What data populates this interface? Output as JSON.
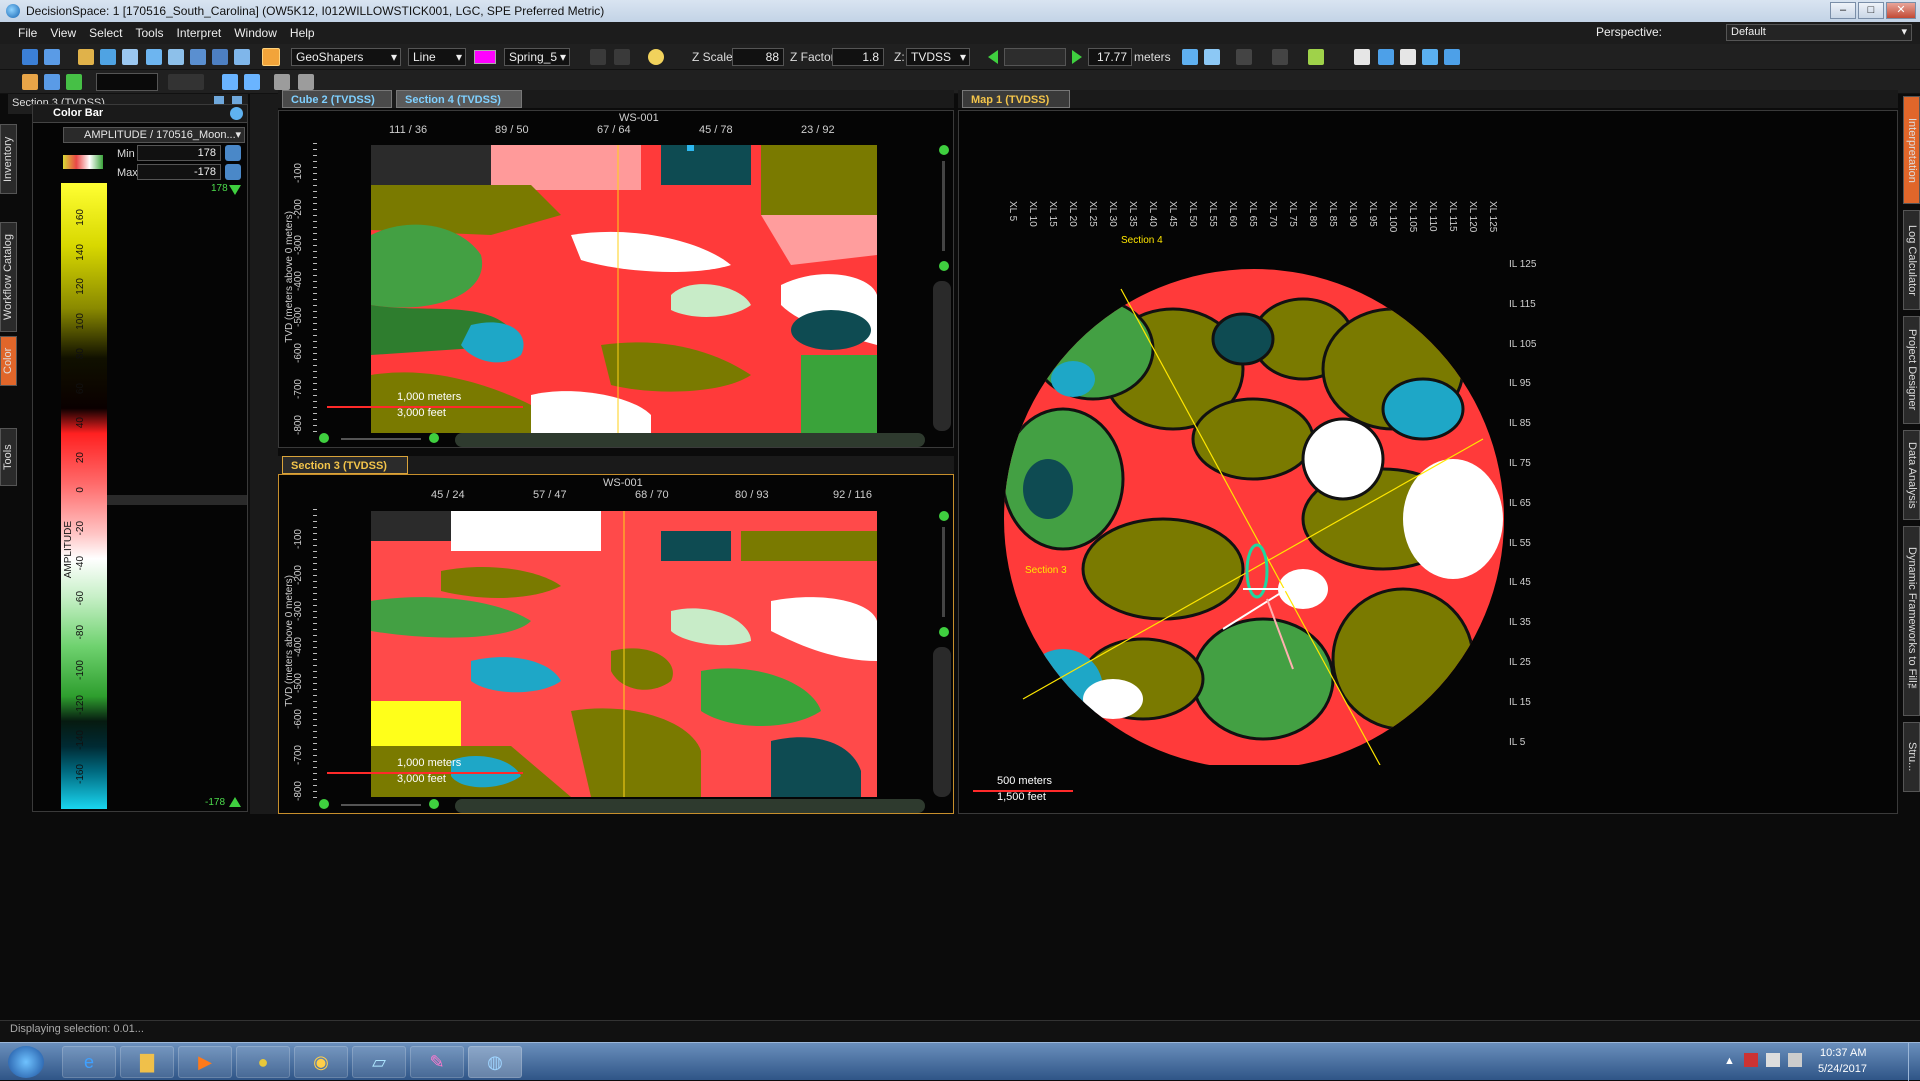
{
  "window": {
    "title": "DecisionSpace: 1 [170516_South_Carolina] (OW5K12, I012WILLOWSTICK001, LGC, SPE Preferred Metric)"
  },
  "menu": [
    "File",
    "View",
    "Select",
    "Tools",
    "Interpret",
    "Window",
    "Help"
  ],
  "perspective": {
    "label": "Perspective:",
    "value": "Default"
  },
  "toolbar": {
    "geoshapers": "GeoShapers",
    "line_mode": "Line",
    "color_scheme": "Spring_5",
    "zscale_label": "Z Scale:",
    "zscale_value": "88",
    "zfactor_label": "Z Factor:",
    "zfactor_value": "1.8",
    "z_label": "Z:",
    "z_value": "TVDSS",
    "distance_value": "17.77",
    "distance_unit": "meters"
  },
  "left_panel": {
    "title": "Section 3 (TVDSS)",
    "colorbar_title": "Color Bar",
    "attribute": "AMPLITUDE / 170516_Moon...",
    "min_label": "Min",
    "min_value": "178",
    "max_label": "Max",
    "max_value": "-178",
    "top_value": "178",
    "bottom_value": "-178",
    "axis_label": "AMPLITUDE",
    "ticks": [
      "160",
      "140",
      "120",
      "100",
      "80",
      "60",
      "40",
      "20",
      "0",
      "-20",
      "-40",
      "-60",
      "-80",
      "-100",
      "-120",
      "-140",
      "-160"
    ],
    "side_tabs": [
      "Inventory",
      "Workflow Catalog",
      "Color",
      "Tools"
    ]
  },
  "views": {
    "cube_tab": "Cube 2 (TVDSS)",
    "section4_tab": "Section 4 (TVDSS)",
    "section3_tab": "Section 3 (TVDSS)",
    "map_tab": "Map 1 (TVDSS)"
  },
  "section4": {
    "well": "WS-001",
    "top_ticks": [
      "111 / 36",
      "89 / 50",
      "67 / 64",
      "45 / 78",
      "23 / 92"
    ],
    "depth_ticks": [
      "-100",
      "-200",
      "-300",
      "-400",
      "-500",
      "-600",
      "-700",
      "-800"
    ],
    "ylabel": "TVD (meters above 0 meters)",
    "scale_m": "1,000 meters",
    "scale_ft": "3,000 feet"
  },
  "section3": {
    "well": "WS-001",
    "top_ticks": [
      "45 / 24",
      "57 / 47",
      "68 / 70",
      "80 / 93",
      "92 / 116"
    ],
    "depth_ticks": [
      "-100",
      "-200",
      "-300",
      "-400",
      "-500",
      "-600",
      "-700",
      "-800"
    ],
    "ylabel": "TVD (meters above 0 meters)",
    "scale_m": "1,000 meters",
    "scale_ft": "3,000 feet"
  },
  "map": {
    "xl_ticks": [
      "XL 5",
      "XL 10",
      "XL 15",
      "XL 20",
      "XL 25",
      "XL 30",
      "XL 35",
      "XL 40",
      "XL 45",
      "XL 50",
      "XL 55",
      "XL 60",
      "XL 65",
      "XL 70",
      "XL 75",
      "XL 80",
      "XL 85",
      "XL 90",
      "XL 95",
      "XL 100",
      "XL 105",
      "XL 110",
      "XL 115",
      "XL 120",
      "XL 125"
    ],
    "il_ticks": [
      "IL 125",
      "IL 115",
      "IL 105",
      "IL 95",
      "IL 85",
      "IL 75",
      "IL 65",
      "IL 55",
      "IL 45",
      "IL 35",
      "IL 25",
      "IL 15",
      "IL 5"
    ],
    "section4_label": "Section 4",
    "section3_label": "Section 3",
    "scale_m": "500 meters",
    "scale_ft": "1,500 feet"
  },
  "right_tabs": [
    "Interpretation",
    "Log Calculator",
    "Project Designer",
    "Data Analysis",
    "Dynamic Frameworks to Fill™",
    "Stru..."
  ],
  "status": {
    "text": "Displaying selection: 0.01..."
  },
  "taskbar": {
    "time": "10:37 AM",
    "date": "5/24/2017"
  }
}
